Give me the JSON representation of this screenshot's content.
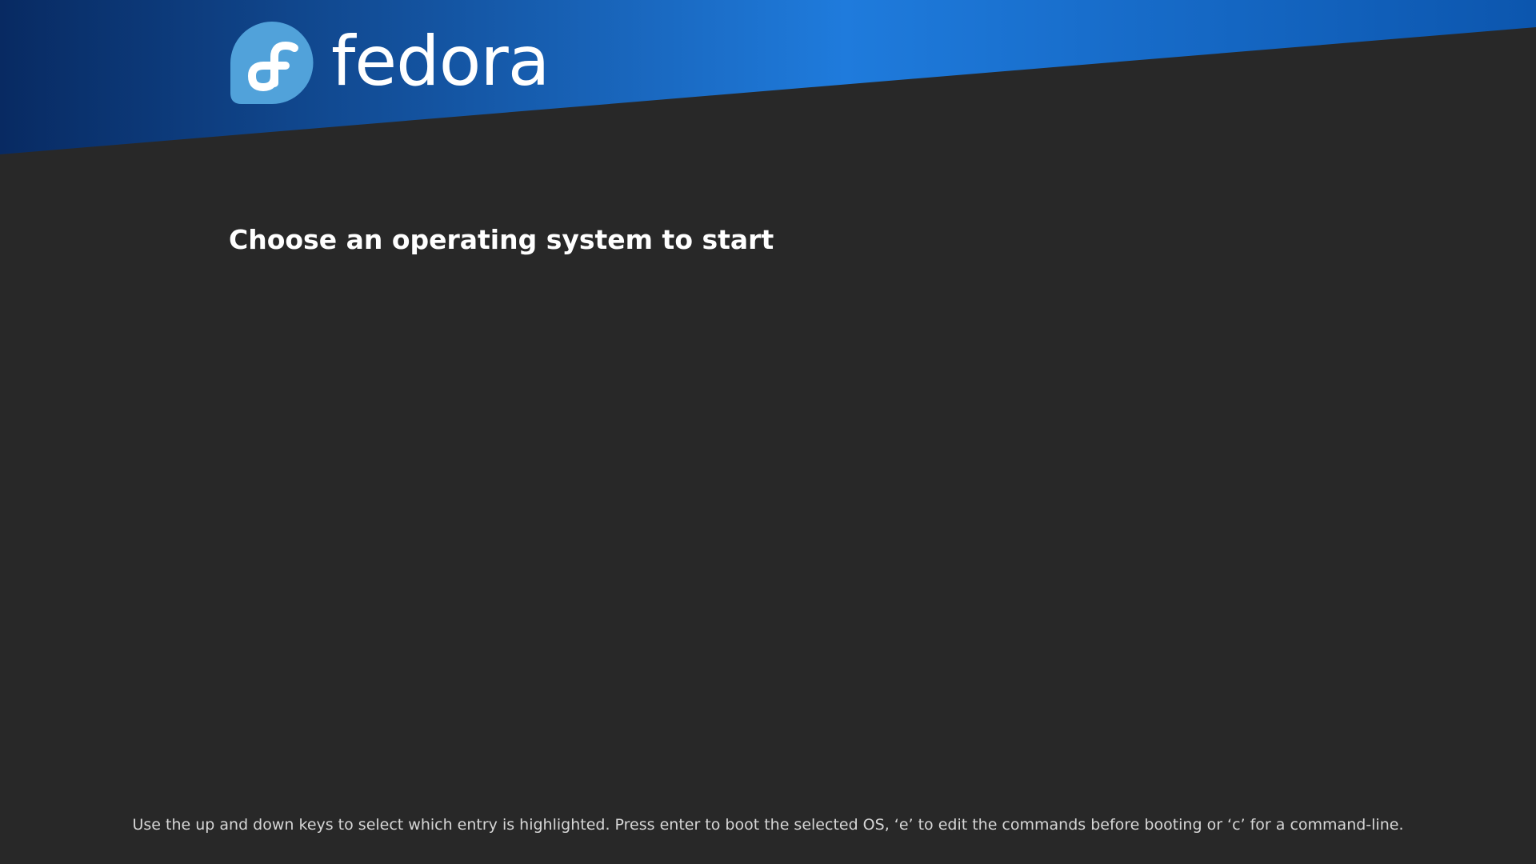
{
  "brand": {
    "name": "fedora",
    "logo_icon": "fedora-infinity-f-icon",
    "logo_color": "#51a2da",
    "banner_gradient": [
      "#082a62",
      "#1f7bdc",
      "#0c56ae"
    ]
  },
  "menu": {
    "title": "Choose an operating system to start",
    "entries": []
  },
  "footer": {
    "help_text": "Use the up and down keys to select which entry is highlighted. Press enter to boot the selected OS, ‘e’ to edit the commands before booting or ‘c’ for a command-line."
  },
  "colors": {
    "background": "#282828",
    "text": "#ffffff",
    "help_text": "#d6d6d6"
  }
}
